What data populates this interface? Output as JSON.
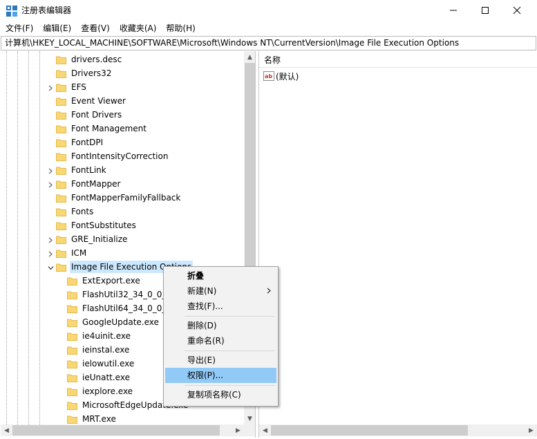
{
  "window": {
    "title": "注册表编辑器",
    "minimize_glyph": "—",
    "maximize_glyph": "☐",
    "close_glyph": "✕"
  },
  "menu": [
    "文件(F)",
    "编辑(E)",
    "查看(V)",
    "收藏夹(A)",
    "帮助(H)"
  ],
  "address": "计算机\\HKEY_LOCAL_MACHINE\\SOFTWARE\\Microsoft\\Windows NT\\CurrentVersion\\Image File Execution Options",
  "tree": {
    "items": [
      {
        "label": "drivers.desc",
        "expander": "none",
        "level": 1
      },
      {
        "label": "Drivers32",
        "expander": "none",
        "level": 1
      },
      {
        "label": "EFS",
        "expander": "collapsed",
        "level": 1
      },
      {
        "label": "Event Viewer",
        "expander": "none",
        "level": 1
      },
      {
        "label": "Font Drivers",
        "expander": "none",
        "level": 1
      },
      {
        "label": "Font Management",
        "expander": "none",
        "level": 1
      },
      {
        "label": "FontDPI",
        "expander": "none",
        "level": 1
      },
      {
        "label": "FontIntensityCorrection",
        "expander": "none",
        "level": 1
      },
      {
        "label": "FontLink",
        "expander": "collapsed",
        "level": 1
      },
      {
        "label": "FontMapper",
        "expander": "collapsed",
        "level": 1
      },
      {
        "label": "FontMapperFamilyFallback",
        "expander": "none",
        "level": 1
      },
      {
        "label": "Fonts",
        "expander": "none",
        "level": 1
      },
      {
        "label": "FontSubstitutes",
        "expander": "none",
        "level": 1
      },
      {
        "label": "GRE_Initialize",
        "expander": "collapsed",
        "level": 1
      },
      {
        "label": "ICM",
        "expander": "collapsed",
        "level": 1
      },
      {
        "label": "Image File Execution Options",
        "expander": "expanded",
        "level": 1,
        "selected": true
      },
      {
        "label": "ExtExport.exe",
        "expander": "none",
        "level": 2
      },
      {
        "label": "FlashUtil32_34_0_0_1",
        "expander": "none",
        "level": 2
      },
      {
        "label": "FlashUtil64_34_0_0_1",
        "expander": "none",
        "level": 2
      },
      {
        "label": "GoogleUpdate.exe",
        "expander": "none",
        "level": 2
      },
      {
        "label": "ie4uinit.exe",
        "expander": "none",
        "level": 2
      },
      {
        "label": "ieinstal.exe",
        "expander": "none",
        "level": 2
      },
      {
        "label": "ielowutil.exe",
        "expander": "none",
        "level": 2
      },
      {
        "label": "ieUnatt.exe",
        "expander": "none",
        "level": 2
      },
      {
        "label": "iexplore.exe",
        "expander": "none",
        "level": 2
      },
      {
        "label": "MicrosoftEdgeUpdate.exe",
        "expander": "none",
        "level": 2
      },
      {
        "label": "MRT.exe",
        "expander": "none",
        "level": 2
      }
    ]
  },
  "values": {
    "column_name": "名称",
    "rows": [
      {
        "name": "(默认)",
        "icon": "string-value-icon"
      }
    ]
  },
  "context_menu": {
    "items": [
      {
        "label": "折叠",
        "bold": true
      },
      {
        "label": "新建(N)",
        "submenu": true
      },
      {
        "label": "查找(F)..."
      },
      {
        "separator": true
      },
      {
        "label": "删除(D)"
      },
      {
        "label": "重命名(R)"
      },
      {
        "separator": true
      },
      {
        "label": "导出(E)"
      },
      {
        "label": "权限(P)...",
        "highlighted": true
      },
      {
        "separator": true
      },
      {
        "label": "复制项名称(C)"
      }
    ]
  },
  "colors": {
    "selection": "#cce8ff",
    "menu_highlight": "#91c9f7",
    "folder": "#f8d775",
    "folder_dark": "#e6b94a"
  }
}
